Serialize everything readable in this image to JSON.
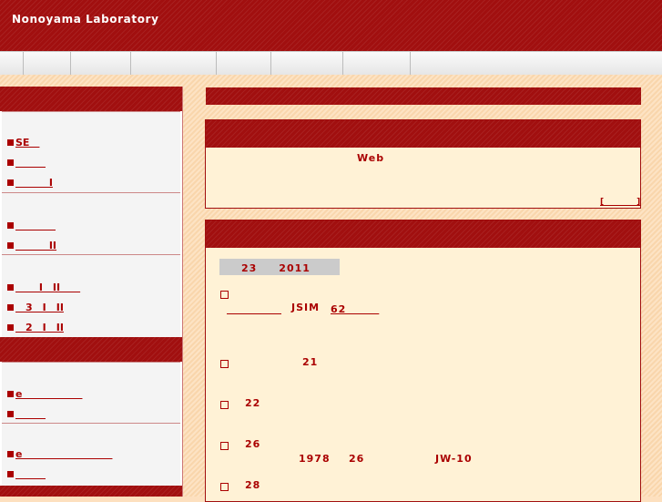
{
  "header": {
    "site_title": "Nonoyama Laboratory"
  },
  "intro": {
    "web_label": "Web",
    "more_link": "[　　　　]"
  },
  "sidebar": {
    "group1": [
      "SE　",
      "　　　",
      "　　　 I"
    ],
    "group2": [
      "　　　　",
      "　　　 II"
    ],
    "group3": [
      "　　 I　II　　",
      "　3　I　II",
      "　2　I　II"
    ],
    "group4": [
      "e　　　　　　",
      "　　　"
    ],
    "group5": [
      "e　　　　　　　　　",
      "　　　"
    ]
  },
  "news": {
    "date_label": "23　　2011",
    "item1_link_a": "　　　　　",
    "item1_text": "JSIM",
    "item1_link_b": "62　　　",
    "item2_text": "21",
    "item3_text": "22",
    "item4_text": "26",
    "item4_sub_year": "1978",
    "item4_sub_num": "26",
    "item4_sub_code": "JW-10",
    "item5_text": "28"
  }
}
